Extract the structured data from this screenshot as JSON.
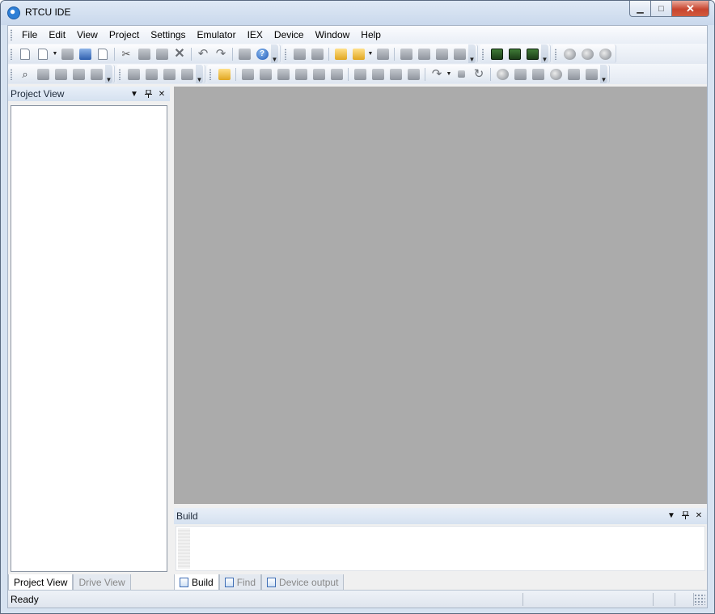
{
  "window": {
    "title": "RTCU IDE",
    "controls": {
      "minimize": "▁",
      "maximize": "□",
      "close": "✕"
    }
  },
  "menubar": {
    "items": [
      "File",
      "Edit",
      "View",
      "Project",
      "Settings",
      "Emulator",
      "IEX",
      "Device",
      "Window",
      "Help"
    ]
  },
  "toolbars": {
    "row1": [
      [
        "new-file-icon",
        "new-dropdown-icon",
        "save-icon",
        "save-all-icon",
        "open-external-icon",
        "cut-icon",
        "copy-icon",
        "paste-icon",
        "delete-icon",
        "undo-icon",
        "redo-icon",
        "print-icon",
        "help-icon"
      ],
      [
        "build-icon",
        "rebuild-icon",
        "open-folder-icon",
        "open-project-icon",
        "close-project-icon",
        "transfer-icon",
        "connect-icon",
        "mail-icon",
        "network-icon"
      ],
      [
        "device-icon",
        "device-alt-icon",
        "device-green-icon"
      ],
      [
        "timer-icon",
        "timer-stop-icon",
        "timer-settings-icon"
      ]
    ],
    "row2": [
      [
        "find-icon",
        "find-next-icon",
        "find-prev-icon",
        "find-in-files-icon",
        "replace-icon"
      ],
      [
        "bookmark-icon",
        "bookmark-next-icon",
        "bookmark-prev-icon",
        "bookmark-clear-icon"
      ],
      [
        "emulator-run-icon",
        "table-icon",
        "memory-icon",
        "register-icon",
        "variables-icon",
        "list-icon",
        "message-icon",
        "chart-icon",
        "watch-icon",
        "tree-icon",
        "io-icon",
        "step-icon",
        "stop-icon",
        "restart-icon",
        "clock-icon",
        "lock-icon",
        "storage-icon",
        "gear-icon",
        "sound-icon",
        "display-icon"
      ]
    ]
  },
  "project_view": {
    "title": "Project View",
    "tabs": [
      {
        "label": "Project View",
        "active": true
      },
      {
        "label": "Drive View",
        "active": false
      }
    ]
  },
  "build_panel": {
    "title": "Build",
    "tabs": [
      {
        "label": "Build",
        "active": true
      },
      {
        "label": "Find",
        "active": false
      },
      {
        "label": "Device output",
        "active": false
      }
    ]
  },
  "pane_controls": {
    "dropdown": "▼",
    "pin": "📌",
    "close": "✕"
  },
  "status": {
    "text": "Ready"
  }
}
